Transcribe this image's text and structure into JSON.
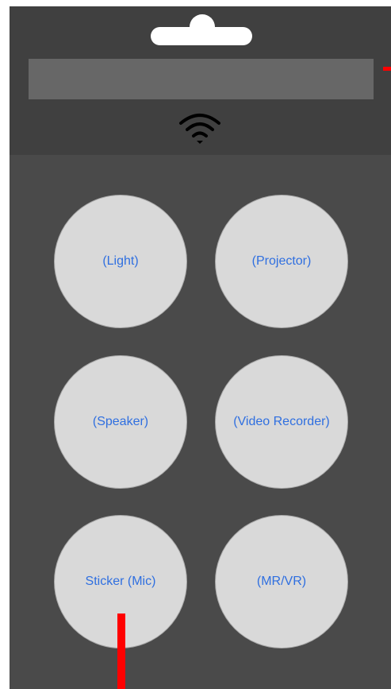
{
  "header": {
    "title": "",
    "connection_icon": "wifi-icon"
  },
  "devices": [
    {
      "label": "(Light)"
    },
    {
      "label": "(Projector)"
    },
    {
      "label": "(Speaker)"
    },
    {
      "label": "(Video Recorder)"
    },
    {
      "label": "Sticker (Mic)"
    },
    {
      "label": "(MR/VR)"
    }
  ],
  "colors": {
    "panel_bg": "#4a4a4a",
    "header_bg": "#404040",
    "title_bar": "#676767",
    "button_fill": "#d9d9d9",
    "button_text": "#2f6fe0",
    "marker": "#ff0000"
  }
}
